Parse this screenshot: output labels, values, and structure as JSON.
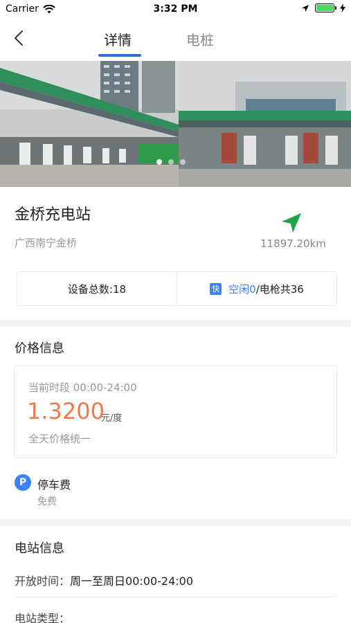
{
  "status_bar": {
    "carrier": "Carrier",
    "time": "3:32 PM"
  },
  "nav": {
    "tabs": [
      {
        "label": "详情",
        "active": true
      },
      {
        "label": "电桩",
        "active": false
      }
    ],
    "accent": "#2e6fd9"
  },
  "gallery": {
    "dots": 3,
    "active_index": 0
  },
  "station": {
    "name": "金桥充电站",
    "address": "广西南宁金桥",
    "distance": "11897.20km"
  },
  "stats": {
    "total_devices": "设备总数:18",
    "fast_badge": "快",
    "idle_label": "空闲0",
    "total_guns": "/电枪共36"
  },
  "price": {
    "section_title": "价格信息",
    "period": "当前时段 00:00-24:00",
    "value": "1.3200",
    "unit": "元/度",
    "note": "全天价格统一",
    "color": "#f07a4a"
  },
  "parking": {
    "icon_letter": "P",
    "label": "停车费",
    "value": "免费"
  },
  "station_info": {
    "section_title": "电站信息",
    "open_time_label": "开放时间：",
    "open_time_value": "周一至周日00:00-24:00",
    "type_label": "电站类型："
  }
}
